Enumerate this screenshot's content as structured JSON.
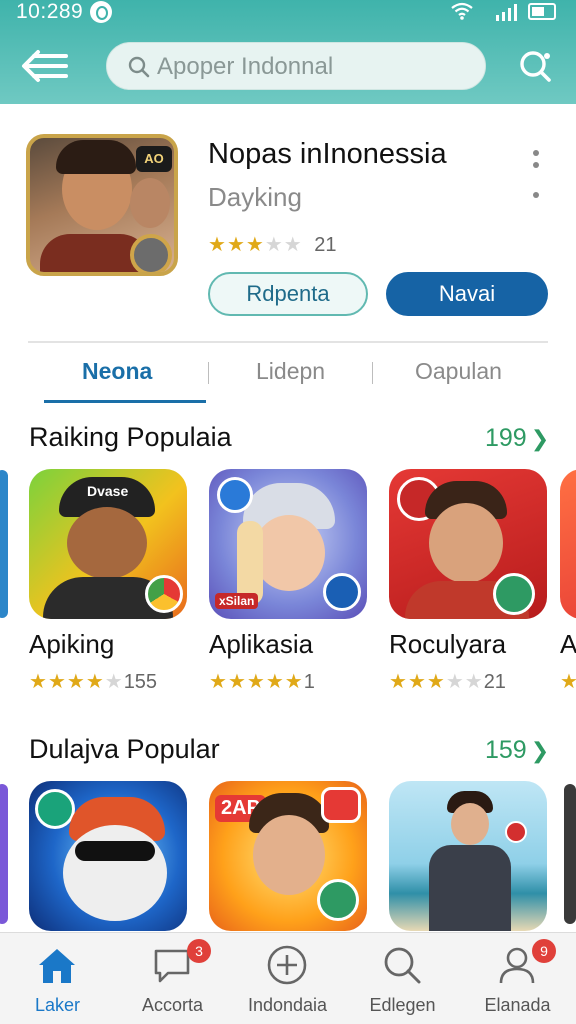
{
  "status_bar": {
    "time": "10:289"
  },
  "search": {
    "placeholder": "Apoper Indonnal"
  },
  "app": {
    "title": "Nopas inInonessia",
    "developer": "Dayking",
    "rating_stars": 3,
    "rating_count": "21",
    "icon_badge": "AO",
    "secondary_button": "Rdpenta",
    "primary_button": "Navai"
  },
  "tabs": [
    {
      "label": "Neona",
      "active": true
    },
    {
      "label": "Lidepn",
      "active": false
    },
    {
      "label": "Oapulan",
      "active": false
    }
  ],
  "sections": [
    {
      "title": "Raiking Populaia",
      "count": "199",
      "cards": [
        {
          "name": "Apiking",
          "stars": 4,
          "count": "155",
          "icon_label": "Dvase"
        },
        {
          "name": "Aplikasia",
          "stars": 5,
          "count": "1",
          "icon_label": "xSilan"
        },
        {
          "name": "Roculyara",
          "stars": 3,
          "count": "21",
          "icon_label": ""
        },
        {
          "name": "A",
          "stars": 1,
          "count": "",
          "icon_label": ""
        }
      ]
    },
    {
      "title": "Dulajva Popular",
      "count": "159",
      "cards": [
        {
          "name": "",
          "stars": 0,
          "count": "",
          "icon_label": ""
        },
        {
          "name": "",
          "stars": 0,
          "count": "",
          "icon_label": "2AP"
        },
        {
          "name": "",
          "stars": 0,
          "count": "",
          "icon_label": ""
        }
      ]
    }
  ],
  "bottom_nav": [
    {
      "label": "Laker",
      "icon": "home-icon",
      "badge": "",
      "active": true
    },
    {
      "label": "Accorta",
      "icon": "chat-icon",
      "badge": "3",
      "active": false
    },
    {
      "label": "Indondaia",
      "icon": "add-circle-icon",
      "badge": "",
      "active": false
    },
    {
      "label": "Edlegen",
      "icon": "search-icon",
      "badge": "",
      "active": false
    },
    {
      "label": "Elanada",
      "icon": "profile-icon",
      "badge": "9",
      "active": false
    }
  ],
  "colors": {
    "header": "#3fb3ab",
    "primary": "#1663a5",
    "accent_green": "#2e9a63",
    "star": "#e0a918",
    "badge": "#e0403a"
  }
}
